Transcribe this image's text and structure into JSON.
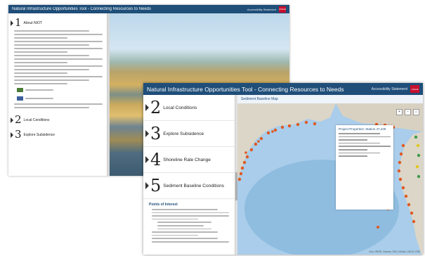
{
  "back_window": {
    "title": "Natural Infrastructure Opportunities Tool - Connecting Resources to Needs",
    "accessibility_link": "Accessibility Statement",
    "logo_label": "USACE",
    "sections": [
      {
        "number": "1",
        "label": "About NIOT"
      },
      {
        "number": "2",
        "label": "Local Conditions"
      },
      {
        "number": "3",
        "label": "Explore Subsidence"
      }
    ]
  },
  "front_window": {
    "title": "Natural Infrastructure Opportunities Tool - Connecting Resources to Needs",
    "accessibility_link": "Accessibility Statement",
    "logo_label": "USACE",
    "sections": [
      {
        "number": "2",
        "label": "Local Conditions"
      },
      {
        "number": "3",
        "label": "Explore Subsidence"
      },
      {
        "number": "4",
        "label": "Shoreline Rate Change"
      },
      {
        "number": "5",
        "label": "Sediment Baseline Conditions"
      }
    ],
    "points_title": "Points of Interest",
    "map": {
      "header": "Sediment Baseline Map",
      "popup_title": "Project Properties: Station 47,249",
      "credit": "Esri, HERE, Garmin, FAO, NOAA, USGS, EPA"
    }
  },
  "colors": {
    "header": "#1f4e79",
    "logo": "#c8102e",
    "land": "#dcd6c8",
    "water": "#a9cdea",
    "marker": "#e0581f"
  }
}
